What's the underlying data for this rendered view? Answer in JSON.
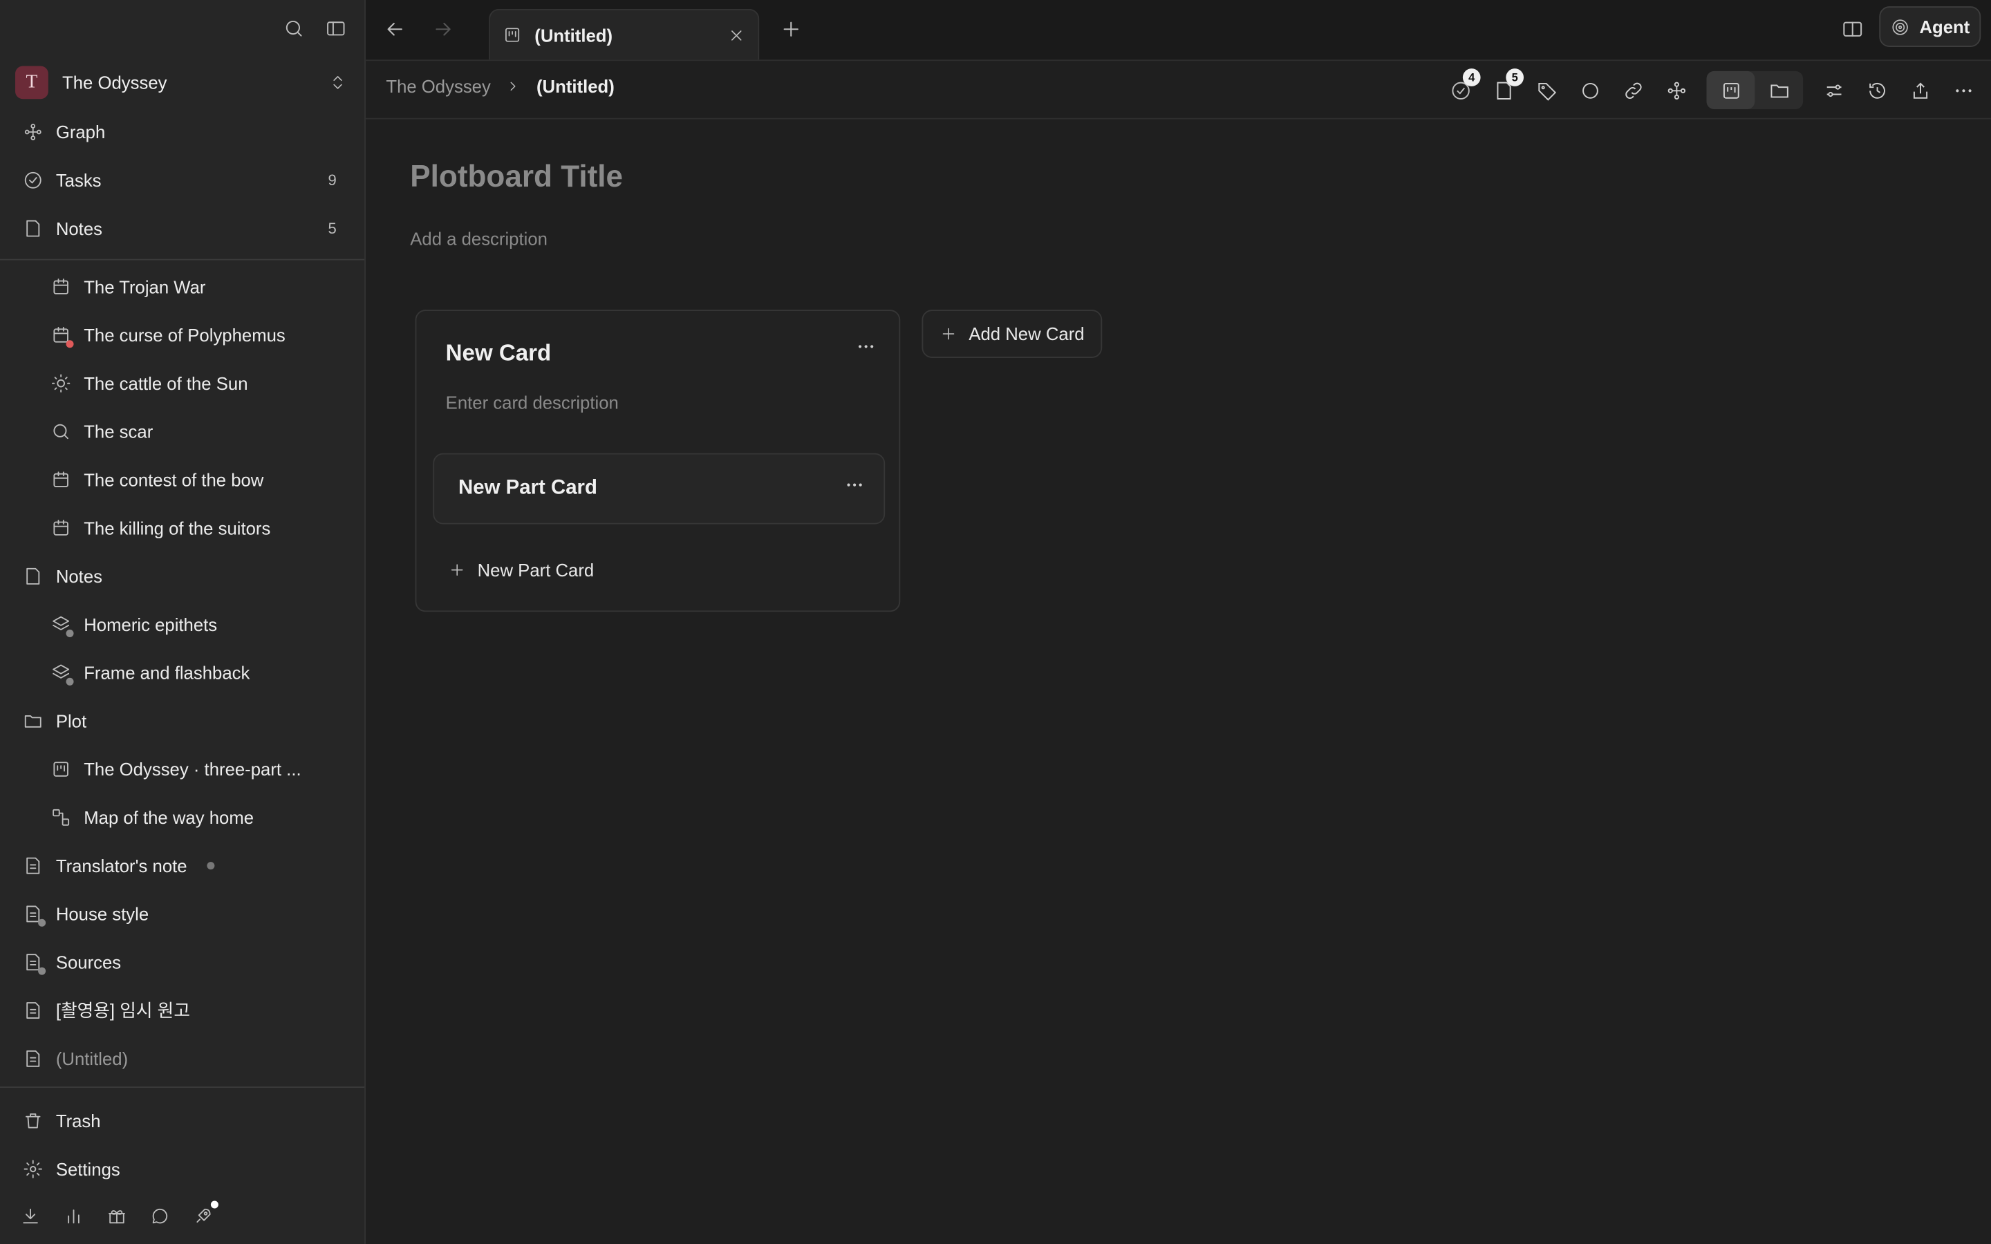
{
  "workspace": {
    "initial": "T",
    "name": "The Odyssey"
  },
  "sidebar": {
    "nav": [
      {
        "label": "Graph",
        "icon": "graph-icon"
      },
      {
        "label": "Tasks",
        "icon": "check-circle-icon",
        "count": "9"
      },
      {
        "label": "Notes",
        "icon": "note-icon",
        "count": "5"
      }
    ],
    "tree": [
      {
        "label": "The Trojan War",
        "icon": "calendar-icon",
        "child": true
      },
      {
        "label": "The curse of Polyphemus",
        "icon": "calendar-icon",
        "child": true
      },
      {
        "label": "The cattle of the Sun",
        "icon": "sun-icon",
        "child": true
      },
      {
        "label": "The scar",
        "icon": "search-icon",
        "child": true
      },
      {
        "label": "The contest of the bow",
        "icon": "calendar-icon",
        "child": true
      },
      {
        "label": "The killing of the suitors",
        "icon": "calendar-icon",
        "child": true
      },
      {
        "label": "Notes",
        "icon": "note-icon",
        "child": false
      },
      {
        "label": "Homeric epithets",
        "icon": "layers-icon",
        "child": true
      },
      {
        "label": "Frame and flashback",
        "icon": "layers-icon",
        "child": true
      },
      {
        "label": "Plot",
        "icon": "folder-icon",
        "child": false
      },
      {
        "label": "The Odyssey · three-part ...",
        "icon": "plotboard-icon",
        "child": true
      },
      {
        "label": "Map of the way home",
        "icon": "map-icon",
        "child": true
      },
      {
        "label": "Translator's note",
        "icon": "document-icon",
        "child": false
      },
      {
        "label": "House style",
        "icon": "document-icon",
        "child": false
      },
      {
        "label": "Sources",
        "icon": "document-icon",
        "child": false
      },
      {
        "label": "[촬영용] 임시 원고",
        "icon": "document-icon",
        "child": false
      },
      {
        "label": "(Untitled)",
        "icon": "document-icon",
        "child": false
      }
    ],
    "trash_label": "Trash",
    "settings_label": "Settings"
  },
  "tabs": [
    {
      "label": "(Untitled)"
    }
  ],
  "agent_label": "Agent",
  "breadcrumb": {
    "root": "The Odyssey",
    "current": "(Untitled)"
  },
  "toolbar": {
    "tasks_count": "4",
    "notes_count": "5"
  },
  "plotboard": {
    "title_placeholder": "Plotboard Title",
    "description_placeholder": "Add a description",
    "card": {
      "title": "New Card",
      "description_placeholder": "Enter card description",
      "part_card_title": "New Part Card",
      "new_part_label": "New Part Card"
    },
    "add_card_label": "Add New Card"
  },
  "colors": {
    "avatar": "#6b2b38",
    "background": "#1f1f1f",
    "sidebar": "#262626"
  }
}
